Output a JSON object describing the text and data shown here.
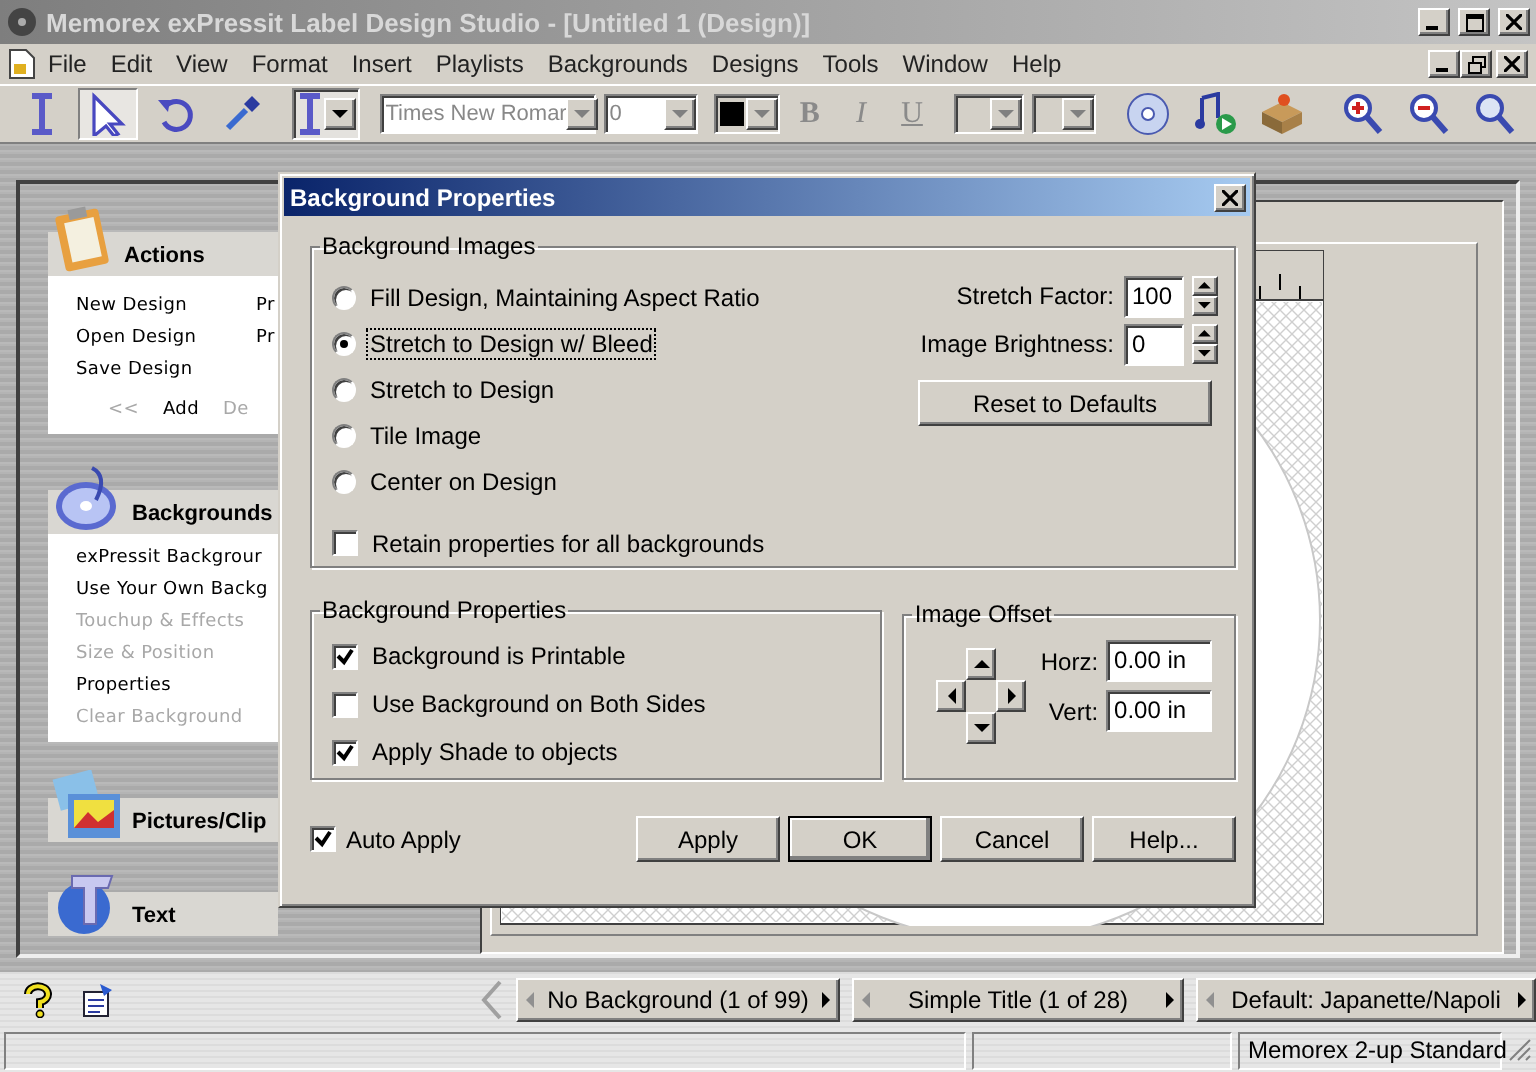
{
  "window": {
    "title": "Memorex exPressit Label Design Studio - [Untitled 1 (Design)]"
  },
  "menu": [
    "File",
    "Edit",
    "View",
    "Format",
    "Insert",
    "Playlists",
    "Backgrounds",
    "Designs",
    "Tools",
    "Window",
    "Help"
  ],
  "toolbar": {
    "tools": [
      {
        "kind": "text",
        "selected": false
      },
      {
        "kind": "pointer",
        "selected": true
      },
      {
        "kind": "rotate",
        "selected": false
      },
      {
        "kind": "eyedropper",
        "selected": false
      }
    ],
    "font": "Times New Romar",
    "size": "0",
    "styles": [
      {
        "kind": "bold",
        "label": "B"
      },
      {
        "kind": "italic",
        "label": "I"
      },
      {
        "kind": "underline",
        "label": "U"
      }
    ],
    "actions": [
      {
        "kind": "disc"
      },
      {
        "kind": "playlist"
      },
      {
        "kind": "package"
      },
      {
        "kind": "zoom-in"
      },
      {
        "kind": "zoom-out"
      },
      {
        "kind": "zoom-find"
      }
    ]
  },
  "sidebar": [
    {
      "title": "Actions",
      "expanded": true,
      "kind": "grid",
      "items": [
        {
          "label": "New Design",
          "disabled": false
        },
        {
          "label": "Pr",
          "disabled": false
        },
        {
          "label": "Open Design",
          "disabled": false
        },
        {
          "label": "Pr",
          "disabled": false
        },
        {
          "label": "Save Design",
          "disabled": false
        }
      ],
      "footer": [
        {
          "label": "<<",
          "disabled": true
        },
        {
          "label": "Add",
          "disabled": false
        },
        {
          "label": "De",
          "disabled": true
        }
      ]
    },
    {
      "title": "Backgrounds",
      "expanded": true,
      "kind": "list",
      "items": [
        {
          "label": "exPressit Backgrour",
          "disabled": false
        },
        {
          "label": "Use Your Own Backg",
          "disabled": false
        },
        {
          "label": "Touchup & Effects",
          "disabled": true
        },
        {
          "label": "Size & Position",
          "disabled": true
        },
        {
          "label": "Properties",
          "disabled": false
        },
        {
          "label": "Clear Background",
          "disabled": true
        }
      ]
    },
    {
      "title": "Pictures/Clip",
      "expanded": false
    },
    {
      "title": "Text",
      "expanded": false
    }
  ],
  "dialog": {
    "title": "Background Properties",
    "images": {
      "label": "Background Images",
      "options": [
        {
          "label": "Fill Design, Maintaining Aspect Ratio",
          "selected": false
        },
        {
          "label": "Stretch to Design w/ Bleed",
          "selected": true
        },
        {
          "label": "Stretch to Design",
          "selected": false
        },
        {
          "label": "Tile Image",
          "selected": false
        },
        {
          "label": "Center on Design",
          "selected": false
        }
      ],
      "retain": {
        "label": "Retain properties for all backgrounds",
        "checked": false
      },
      "spinners": [
        {
          "label": "Stretch Factor:",
          "value": "100"
        },
        {
          "label": "Image Brightness:",
          "value": "0"
        }
      ],
      "reset": "Reset to Defaults"
    },
    "properties": {
      "label": "Background Properties",
      "checkboxes": [
        {
          "label": "Background is Printable",
          "checked": true
        },
        {
          "label": "Use Background on Both Sides",
          "checked": false
        },
        {
          "label": "Apply Shade to objects",
          "checked": true
        }
      ]
    },
    "offset": {
      "label": "Image Offset",
      "fields": [
        {
          "label": "Horz:",
          "value": "0.00 in"
        },
        {
          "label": "Vert:",
          "value": "0.00 in"
        }
      ]
    },
    "auto_apply": {
      "label": "Auto Apply",
      "checked": true
    },
    "buttons": [
      {
        "label": "Apply",
        "default": false
      },
      {
        "label": "OK",
        "default": true
      },
      {
        "label": "Cancel",
        "default": false
      },
      {
        "label": "Help...",
        "default": false
      }
    ]
  },
  "navigator": [
    "No Background (1 of 99)",
    "Simple Title (1 of 28)",
    "Default: Japanette/Napoli"
  ],
  "status_bar": {
    "text": "Memorex 2-up Standard"
  }
}
